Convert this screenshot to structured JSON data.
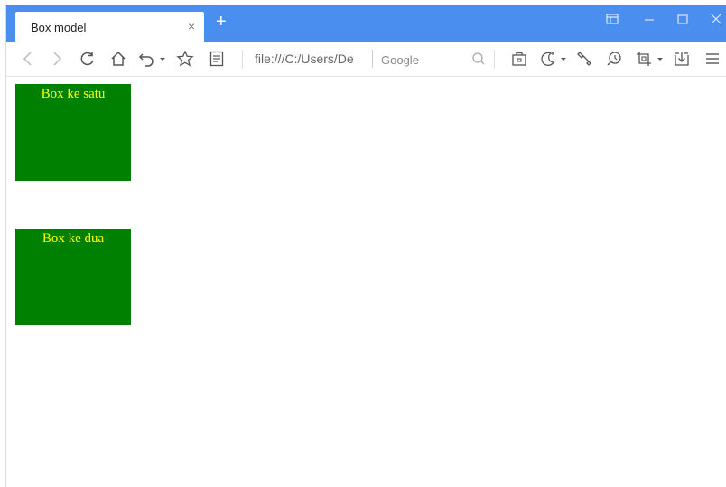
{
  "browser": {
    "tab": {
      "title": "Box model",
      "close_glyph": "×"
    },
    "new_tab_glyph": "+",
    "address_bar": {
      "url": "file:///C:/Users/De"
    },
    "search_box": {
      "placeholder": "Google"
    },
    "window_controls": [
      "sidebar-layout-icon",
      "minimize-icon",
      "maximize-icon",
      "close-icon"
    ]
  },
  "page": {
    "boxes": [
      {
        "label": "Box ke satu"
      },
      {
        "label": "Box ke dua"
      }
    ]
  },
  "colors": {
    "titlebar": "#4a8ef0",
    "box_bg": "#008000",
    "box_text": "#ffff00"
  }
}
